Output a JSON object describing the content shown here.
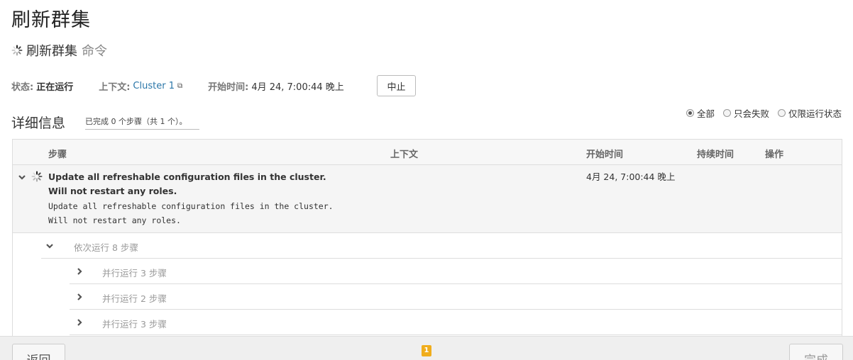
{
  "page": {
    "title": "刷新群集"
  },
  "command": {
    "name": "刷新群集",
    "suffix": "命令"
  },
  "meta": {
    "status_label": "状态:",
    "status_value": "正在运行",
    "context_label": "上下文:",
    "context_value": "Cluster 1",
    "start_label": "开始时间:",
    "start_value": "4月 24, 7:00:44 晚上",
    "abort_label": "中止"
  },
  "details": {
    "title": "详细信息",
    "progress": "已完成 0 个步骤（共 1 个）。"
  },
  "filters": [
    {
      "label": "全部",
      "checked": true
    },
    {
      "label": "只会失败",
      "checked": false
    },
    {
      "label": "仅限运行状态",
      "checked": false
    }
  ],
  "table": {
    "headers": {
      "step": "步骤",
      "context": "上下文",
      "start": "开始时间",
      "duration": "持续时间",
      "actions": "操作"
    },
    "main_step": {
      "title": "Update all refreshable configuration files in the cluster. Will not restart any roles.",
      "description": "Update all refreshable configuration files in the cluster.\nWill not restart any roles.",
      "start_time": "4月 24, 7:00:44 晚上"
    },
    "sequential": "依次运行 8 步骤",
    "parallel": [
      "并行运行 3 步骤",
      "并行运行 2 步骤",
      "并行运行 3 步骤"
    ]
  },
  "footer": {
    "back_label": "返回",
    "finish_label": "完成",
    "badge": "1"
  },
  "colors": {
    "link": "#2a76a8",
    "badge": "#f0ad1c"
  }
}
